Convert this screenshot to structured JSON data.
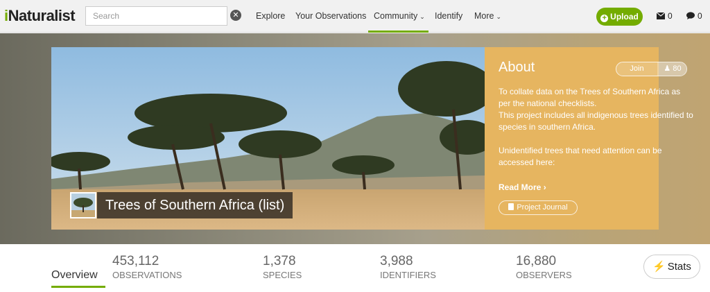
{
  "header": {
    "logo_first": "i",
    "logo_rest": "Naturalist",
    "search_placeholder": "Search",
    "clear_glyph": "✕",
    "nav": {
      "explore": "Explore",
      "your_observations": "Your Observations",
      "community": "Community",
      "identify": "Identify",
      "more": "More"
    },
    "caret_glyph": "⌄",
    "upload_label": "Upload",
    "messages_count": "0",
    "notifications_count": "0",
    "accent_color": "#74ac00"
  },
  "project": {
    "title": "Trees of Southern Africa (list)",
    "about": {
      "heading": "About",
      "join_label": "Join",
      "members_count": "80",
      "description": "To collate data on the Trees of Southern Africa as per the national checklists.",
      "description2": "This project includes all indigenous trees identified to species in southern Africa.",
      "description3": "Unidentified trees that need attention can be accessed here:",
      "read_more": "Read More",
      "journal_label": "Project Journal",
      "panel_color": "#e6b560"
    }
  },
  "stats": {
    "tab_label": "Overview",
    "items": [
      {
        "value": "453,112",
        "label": "OBSERVATIONS"
      },
      {
        "value": "1,378",
        "label": "SPECIES"
      },
      {
        "value": "3,988",
        "label": "IDENTIFIERS"
      },
      {
        "value": "16,880",
        "label": "OBSERVERS"
      }
    ],
    "button_label": "Stats"
  }
}
